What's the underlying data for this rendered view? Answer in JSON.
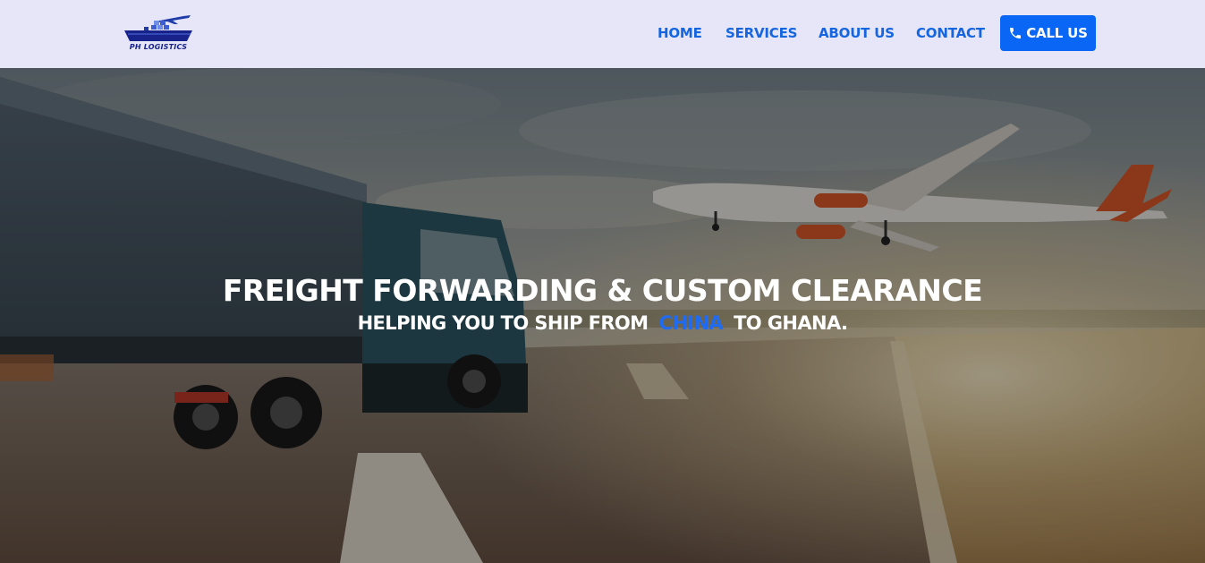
{
  "brand": {
    "logo_text": "PH LOGISTICS",
    "logo_icon": "ship-plane-logo-icon"
  },
  "nav": {
    "home": "HOME",
    "services": "SERVICES",
    "about": "ABOUT US",
    "contact": "CONTACT"
  },
  "call_button": {
    "label": "CALL US",
    "icon": "phone-icon"
  },
  "hero": {
    "title": "FREIGHT FORWARDING & CUSTOM CLEARANCE",
    "subtitle_prefix": "HELPING YOU TO SHIP FROM",
    "subtitle_highlight": "CHINA",
    "subtitle_suffix": "TO GHANA.",
    "background_image": "truck-and-airplane-road-photo"
  },
  "colors": {
    "header_bg": "#e6e6f8",
    "nav_link": "#1565e0",
    "call_button_bg": "#0a66f5",
    "highlight": "#1f6cf2",
    "hero_text": "#ffffff"
  }
}
